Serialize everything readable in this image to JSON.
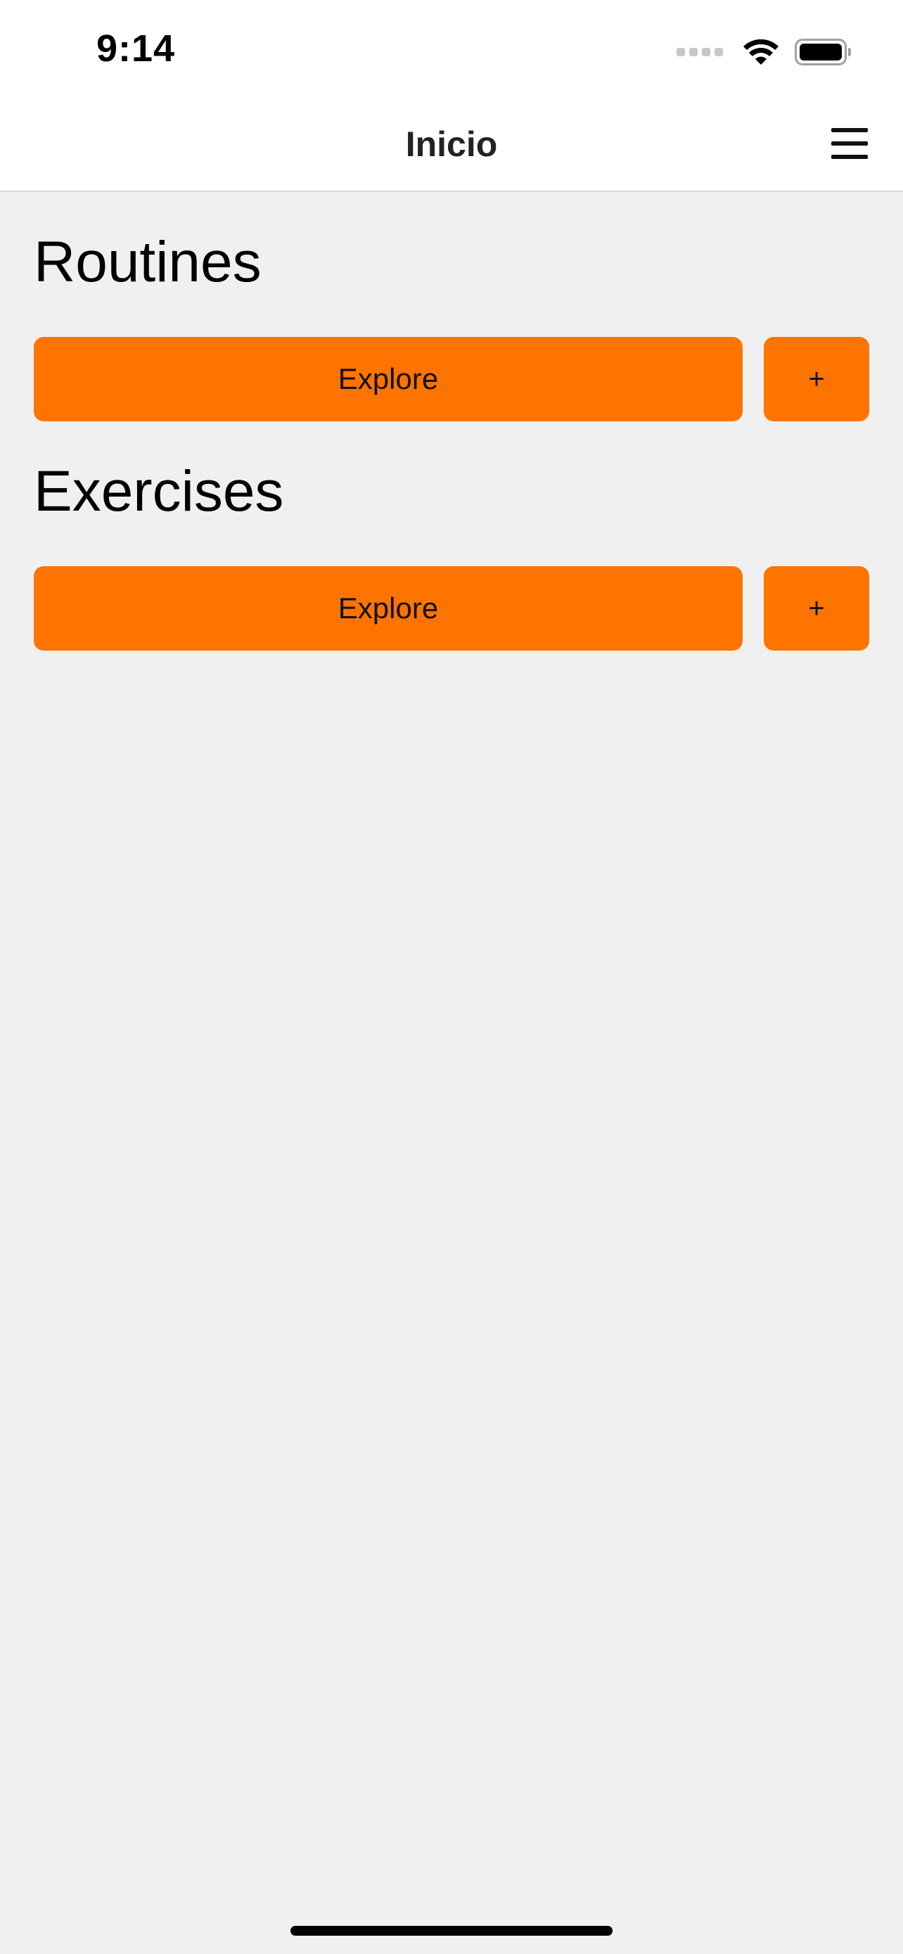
{
  "status_bar": {
    "time": "9:14",
    "icons": [
      "signal-dots-icon",
      "wifi-icon",
      "battery-icon"
    ],
    "battery_level": 1.0
  },
  "nav": {
    "title": "Inicio",
    "menu_icon": "hamburger-menu-icon"
  },
  "sections": [
    {
      "title": "Routines",
      "explore_label": "Explore",
      "add_label": "+"
    },
    {
      "title": "Exercises",
      "explore_label": "Explore",
      "add_label": "+"
    }
  ],
  "colors": {
    "accent": "#ff7400",
    "background": "#f0f0f0",
    "bar_background": "#ffffff"
  }
}
